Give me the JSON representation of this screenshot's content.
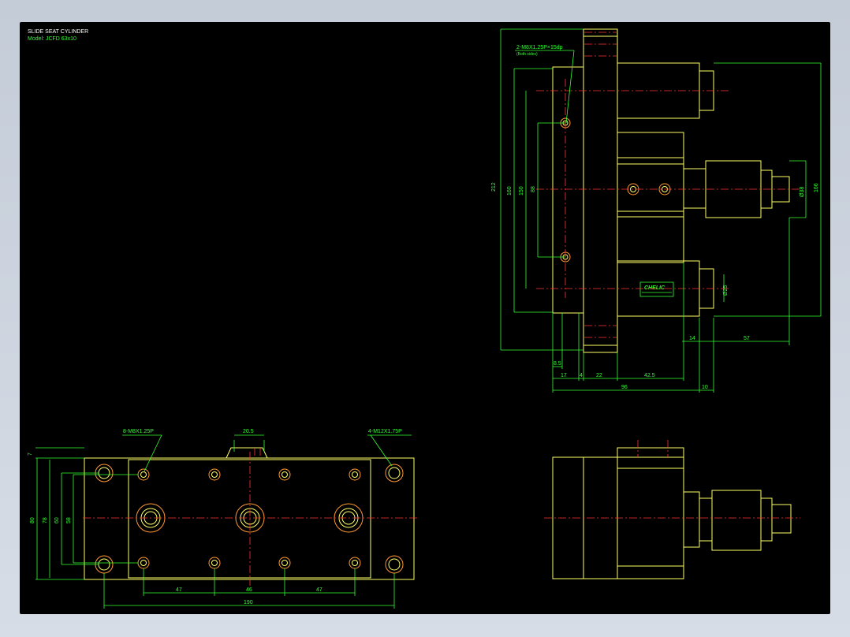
{
  "title_block": {
    "title": "SLIDE SEAT CYLINDER",
    "model": "Model: JCFD 63x10"
  },
  "bottom_view": {
    "callout_left": "8-M8X1.25P",
    "callout_right": "4-M12X1.75P",
    "dim_top": "20.5",
    "dim_left_7": "7",
    "dim_80": "80",
    "dim_78": "78",
    "dim_60": "60",
    "dim_58": "58",
    "dim_47a": "47",
    "dim_46": "46",
    "dim_47b": "47",
    "dim_190": "190"
  },
  "side_view": {
    "callout": "2-M8X1.25P×15dp",
    "callout_sub": "(Both sides)",
    "brand": "CHELIC",
    "dim_212": "212",
    "dim_160": "160",
    "dim_150": "150",
    "dim_88": "88",
    "dim_166": "166",
    "dim_38": "Ø38",
    "dim_25": "Ø25",
    "dim_14": "14",
    "dim_57": "57",
    "dim_8_5": "8.5",
    "dim_17": "17",
    "dim_4": "4",
    "dim_22": "22",
    "dim_42_5": "42.5",
    "dim_96": "96",
    "dim_10": "10"
  },
  "colors": {
    "background": "#000000",
    "outline": "#ffff66",
    "dimension": "#33ff33",
    "centerline": "#ff3333",
    "knurl": "#9933cc"
  }
}
